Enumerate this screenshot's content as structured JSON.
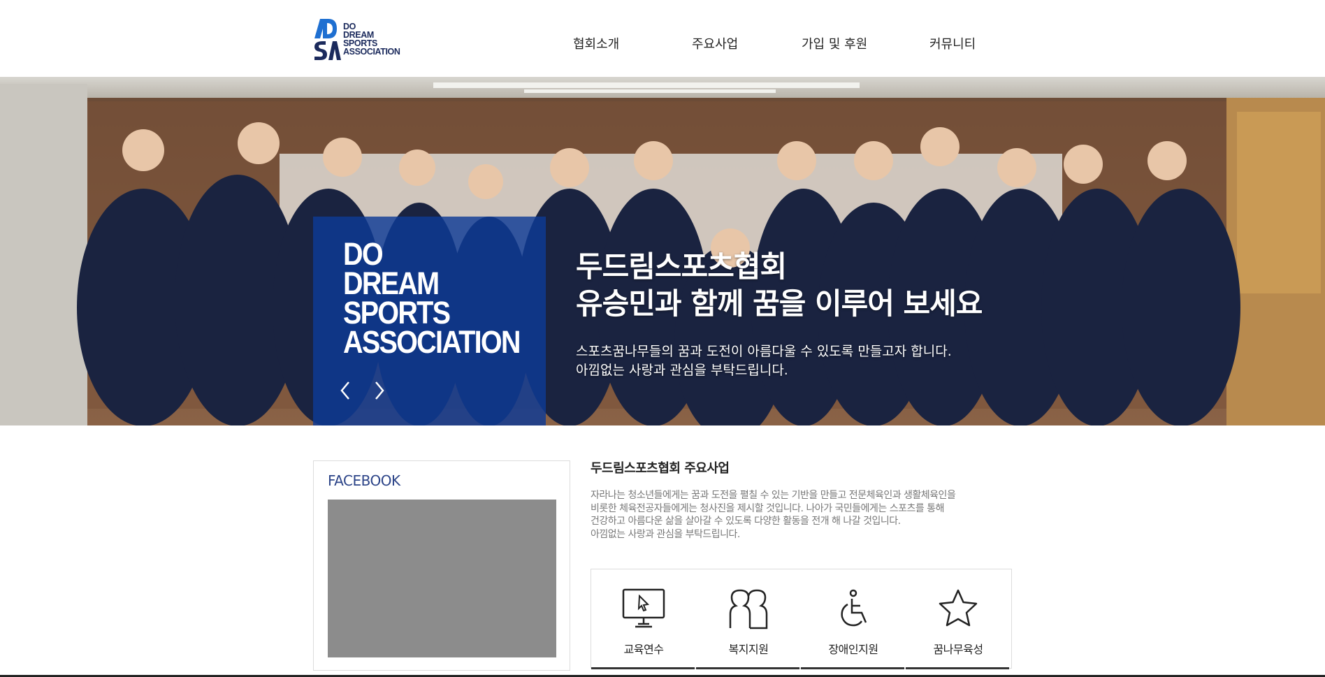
{
  "header": {
    "logo_text": "DO\nDREAM\nSPORTS\nASSOCIATION",
    "nav": [
      {
        "label": "협회소개"
      },
      {
        "label": "주요사업"
      },
      {
        "label": "가입 및 후원"
      },
      {
        "label": "커뮤니티"
      }
    ]
  },
  "hero": {
    "box_title": "DO\nDREAM\nSPORTS\nASSOCIATION",
    "headline_1": "두드림스포츠협회",
    "headline_2": "유승민과 함께 꿈을 이루어 보세요",
    "sub_1": "스포츠꿈나무들의 꿈과 도전이 아름다울 수 있도록 만들고자 합니다.",
    "sub_2": "아낌없는 사랑과 관심을 부탁드립니다.",
    "prev_icon": "chevron-left-icon",
    "next_icon": "chevron-right-icon"
  },
  "facebook": {
    "title": "FACEBOOK"
  },
  "business": {
    "title": "두드림스포츠협회 주요사업",
    "description": "자라나는 청소년들에게는 꿈과 도전을 펼칠 수 있는 기반을 만들고 전문체육인과 생활체육인을\n비롯한 체육전공자들에게는 청사진을 제시할 것입니다. 나아가 국민들에게는 스포츠를 통해\n건강하고 아름다운 삶을 살아갈 수 있도록 다양한 활동을 전개 해 나갈 것입니다.\n아낌없는 사랑과 관심을 부탁드립니다.",
    "services": [
      {
        "label": "교육연수",
        "icon": "monitor-cursor-icon"
      },
      {
        "label": "복지지원",
        "icon": "people-icon"
      },
      {
        "label": "장애인지원",
        "icon": "wheelchair-icon"
      },
      {
        "label": "꿈나무육성",
        "icon": "star-icon"
      }
    ]
  },
  "colors": {
    "brand_blue": "#0d3a96",
    "nav_text": "#222222",
    "facebook_title": "#2c4488"
  }
}
